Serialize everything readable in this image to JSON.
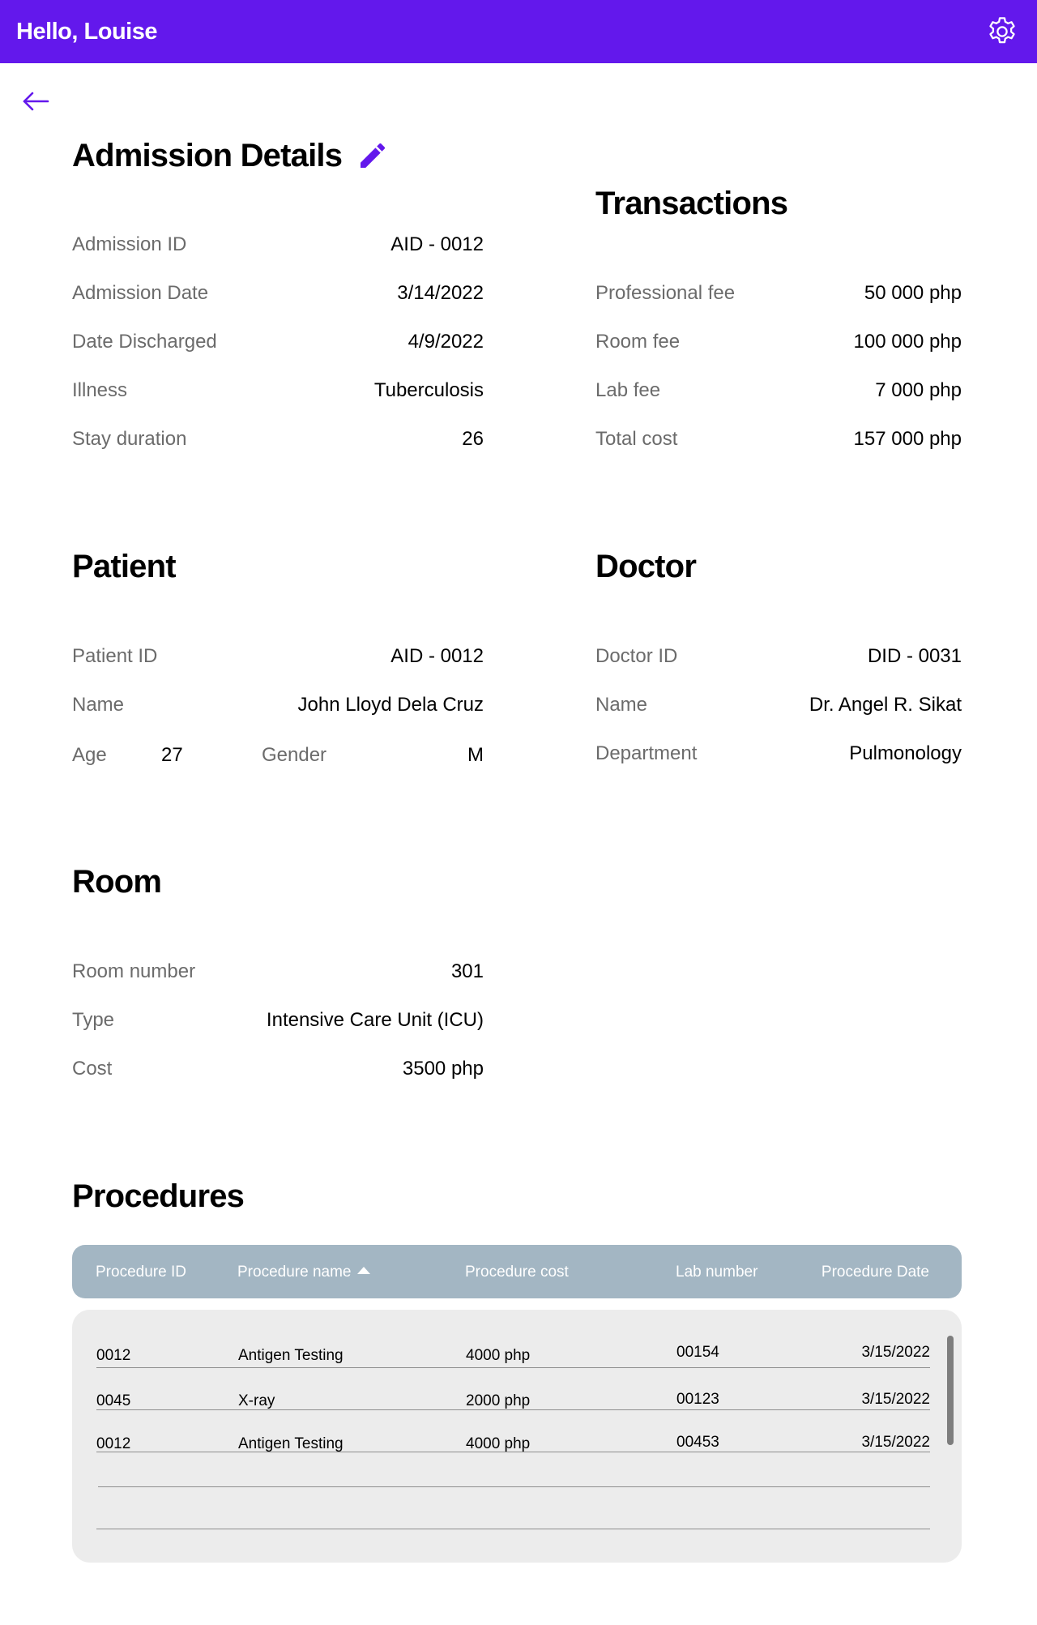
{
  "header": {
    "greeting": "Hello, Louise",
    "settings_icon": "gear-icon"
  },
  "nav": {
    "back_icon": "arrow-left-icon"
  },
  "brand_color": "#6318EC",
  "admission": {
    "title": "Admission Details",
    "edit_icon": "pencil-icon",
    "fields": [
      {
        "label": "Admission ID",
        "value": "AID - 0012"
      },
      {
        "label": "Admission Date",
        "value": "3/14/2022"
      },
      {
        "label": "Date Discharged",
        "value": "4/9/2022"
      },
      {
        "label": "Illness",
        "value": "Tuberculosis"
      },
      {
        "label": "Stay duration",
        "value": "26"
      }
    ]
  },
  "transactions": {
    "title": "Transactions",
    "fields": [
      {
        "label": "Professional fee",
        "value": "50 000 php"
      },
      {
        "label": "Room fee",
        "value": "100 000 php"
      },
      {
        "label": "Lab fee",
        "value": "7 000 php"
      },
      {
        "label": "Total cost",
        "value": "157 000 php"
      }
    ]
  },
  "patient": {
    "title": "Patient",
    "fields": [
      {
        "label": "Patient ID",
        "value": "AID - 0012"
      },
      {
        "label": "Name",
        "value": "John Lloyd Dela Cruz"
      }
    ],
    "age_label": "Age",
    "age_value": "27",
    "gender_label": "Gender",
    "gender_value": "M"
  },
  "doctor": {
    "title": "Doctor",
    "fields": [
      {
        "label": "Doctor ID",
        "value": "DID - 0031"
      },
      {
        "label": "Name",
        "value": "Dr. Angel R. Sikat"
      },
      {
        "label": "Department",
        "value": "Pulmonology"
      }
    ]
  },
  "room": {
    "title": "Room",
    "fields": [
      {
        "label": "Room number",
        "value": "301"
      },
      {
        "label": "Type",
        "value": "Intensive Care Unit (ICU)"
      },
      {
        "label": "Cost",
        "value": "3500 php"
      }
    ]
  },
  "procedures": {
    "title": "Procedures",
    "columns": [
      "Procedure ID",
      "Procedure name",
      "Procedure cost",
      "Lab number",
      "Procedure Date"
    ],
    "sorted_column": "Procedure name",
    "sort_direction": "ascending",
    "rows": [
      [
        "0012",
        "Antigen Testing",
        "4000 php",
        "00154",
        "3/15/2022"
      ],
      [
        "0045",
        "X-ray",
        "2000 php",
        "00123",
        "3/15/2022"
      ],
      [
        "0012",
        "Antigen Testing",
        "4000 php",
        "00453",
        "3/15/2022"
      ]
    ]
  }
}
